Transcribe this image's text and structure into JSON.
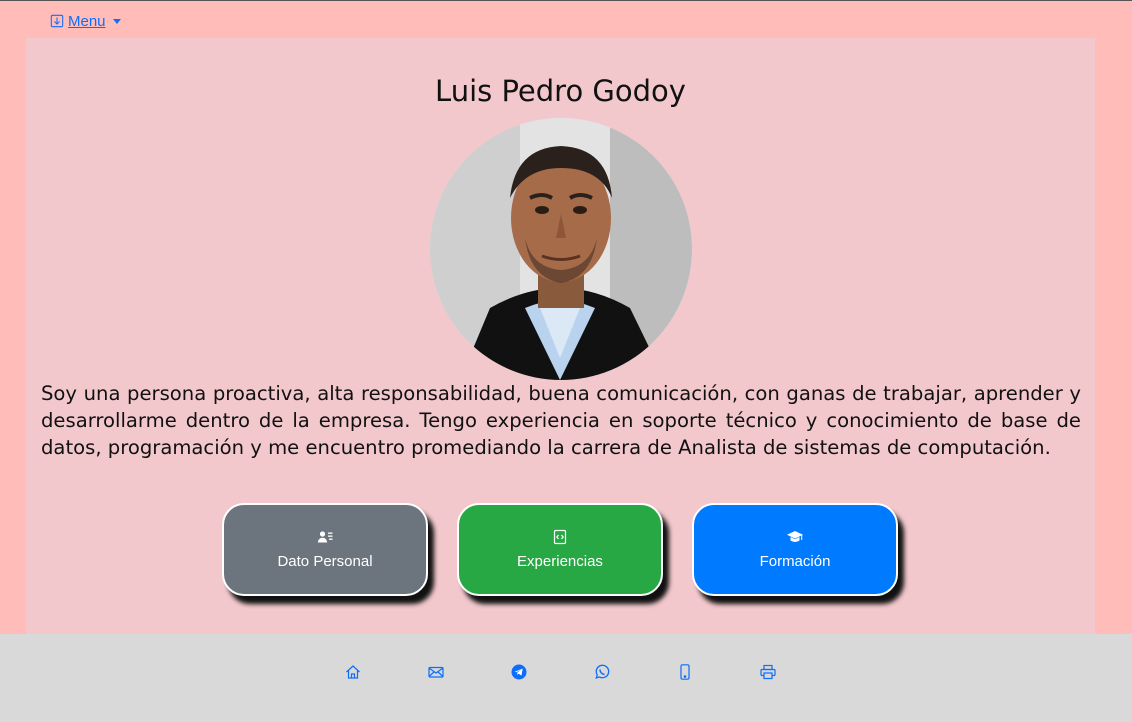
{
  "nav": {
    "menu_label": "Menu"
  },
  "profile": {
    "name": "Luis Pedro Godoy",
    "bio": "Soy una persona proactiva, alta responsabilidad, buena comunicación, con ganas de trabajar, aprender y desarrollarme dentro de la empresa. Tengo experiencia en soporte técnico y conocimiento de base de datos, programación y me encuentro promediando la carrera de Analista de sistemas de computación."
  },
  "buttons": {
    "personal": "Dato Personal",
    "experience": "Experiencias",
    "education": "Formación"
  },
  "footer_icons": [
    "house-icon",
    "envelope-icon",
    "telegram-icon",
    "whatsapp-icon",
    "phone-icon",
    "printer-icon"
  ],
  "colors": {
    "page_bg": "#ffbcb8",
    "card_bg": "#f2c8cd",
    "link": "#0d6efd",
    "btn_personal": "#6c757d",
    "btn_experience": "#28a745",
    "btn_education": "#007bff",
    "footer_bg": "#d9d9d9"
  }
}
